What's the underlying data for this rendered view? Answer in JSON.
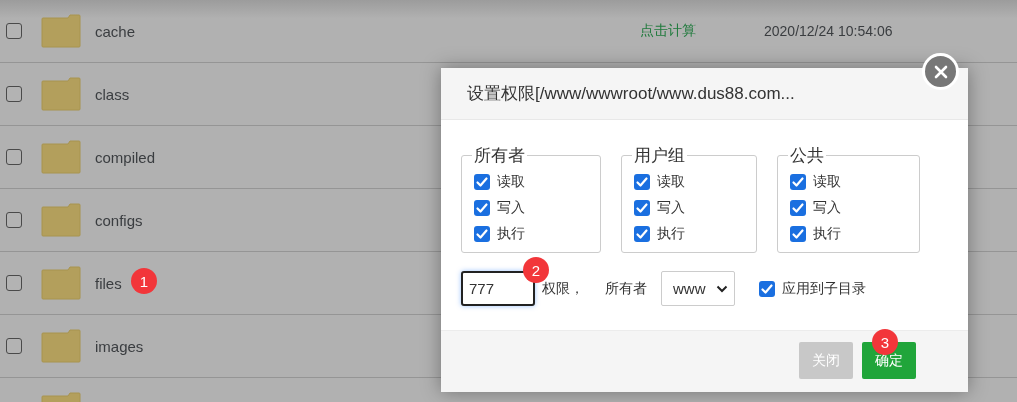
{
  "file_rows": [
    {
      "name": "cache",
      "checked": false,
      "size": "点击计算",
      "modified": "2020/12/24 10:54:06"
    },
    {
      "name": "class",
      "checked": false
    },
    {
      "name": "compiled",
      "checked": false
    },
    {
      "name": "configs",
      "checked": false
    },
    {
      "name": "files",
      "checked": false
    },
    {
      "name": "images",
      "checked": false
    },
    {}
  ],
  "dialog": {
    "title": "设置权限[/www/wwwroot/www.dus88.com...",
    "groups": [
      {
        "legend": "所有者",
        "options": [
          {
            "label": "读取",
            "checked": true
          },
          {
            "label": "写入",
            "checked": true
          },
          {
            "label": "执行",
            "checked": true
          }
        ]
      },
      {
        "legend": "用户组",
        "options": [
          {
            "label": "读取",
            "checked": true
          },
          {
            "label": "写入",
            "checked": true
          },
          {
            "label": "执行",
            "checked": true
          }
        ]
      },
      {
        "legend": "公共",
        "options": [
          {
            "label": "读取",
            "checked": true
          },
          {
            "label": "写入",
            "checked": true
          },
          {
            "label": "执行",
            "checked": true
          }
        ]
      }
    ],
    "permission_value": "777",
    "permission_label": "权限，",
    "owner_label": "所有者",
    "owner_select": "www",
    "apply_subdir": {
      "label": "应用到子目录",
      "checked": true
    },
    "buttons": [
      {
        "label": "关闭",
        "kind": "secondary"
      },
      {
        "label": "确定",
        "kind": "primary"
      }
    ]
  },
  "step_badges": [
    {
      "label": "1"
    },
    {
      "label": "2"
    },
    {
      "label": "3"
    }
  ]
}
